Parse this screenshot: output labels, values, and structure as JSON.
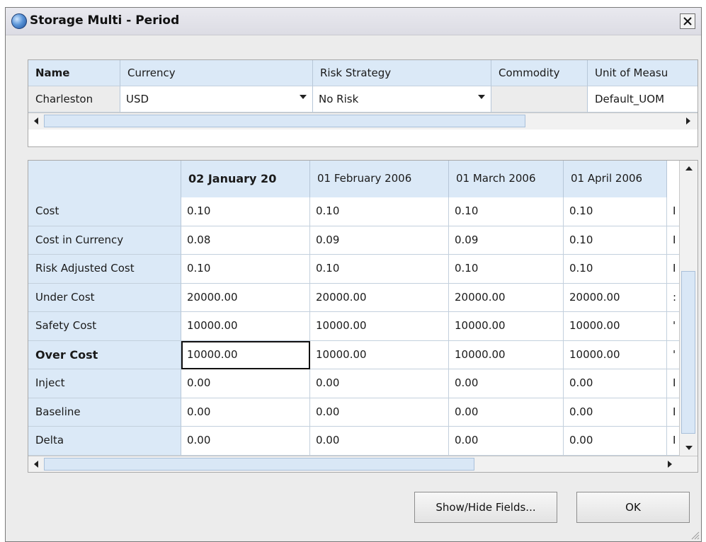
{
  "window": {
    "title": "Storage Multi - Period",
    "close_label": "×"
  },
  "record_grid": {
    "headers": [
      "Name",
      "Currency",
      "Risk Strategy",
      "Commodity",
      "Unit of Measu"
    ],
    "values": {
      "name": "Charleston",
      "currency": "USD",
      "risk_strategy": "No Risk",
      "commodity": "",
      "unit_of_measure": "Default_UOM"
    }
  },
  "data_grid": {
    "columns": [
      "",
      "02 January 20",
      "01 February 2006",
      "01 March 2006",
      "01 April 2006"
    ],
    "rows": [
      {
        "label": "Cost",
        "values": [
          "0.10",
          "0.10",
          "0.10",
          "0.10"
        ],
        "overflow": "I"
      },
      {
        "label": "Cost in Currency",
        "values": [
          "0.08",
          "0.09",
          "0.09",
          "0.10"
        ],
        "overflow": "I"
      },
      {
        "label": "Risk Adjusted Cost",
        "values": [
          "0.10",
          "0.10",
          "0.10",
          "0.10"
        ],
        "overflow": "I"
      },
      {
        "label": "Under Cost",
        "values": [
          "20000.00",
          "20000.00",
          "20000.00",
          "20000.00"
        ],
        "overflow": ":"
      },
      {
        "label": "Safety Cost",
        "values": [
          "10000.00",
          "10000.00",
          "10000.00",
          "10000.00"
        ],
        "overflow": "'"
      },
      {
        "label": "Over Cost",
        "values": [
          "10000.00",
          "10000.00",
          "10000.00",
          "10000.00"
        ],
        "overflow": "'"
      },
      {
        "label": "Inject",
        "values": [
          "0.00",
          "0.00",
          "0.00",
          "0.00"
        ],
        "overflow": "I"
      },
      {
        "label": "Baseline",
        "values": [
          "0.00",
          "0.00",
          "0.00",
          "0.00"
        ],
        "overflow": "I"
      },
      {
        "label": "Delta",
        "values": [
          "0.00",
          "0.00",
          "0.00",
          "0.00"
        ],
        "overflow": "I"
      }
    ]
  },
  "buttons": {
    "show_hide": "Show/Hide Fields...",
    "ok": "OK"
  },
  "colors": {
    "header_blue": "#dbe9f7",
    "window_bg": "#ececec"
  },
  "icons": {
    "title": "globe-icon",
    "close": "close-icon",
    "dropdown": "chevron-down-icon"
  }
}
